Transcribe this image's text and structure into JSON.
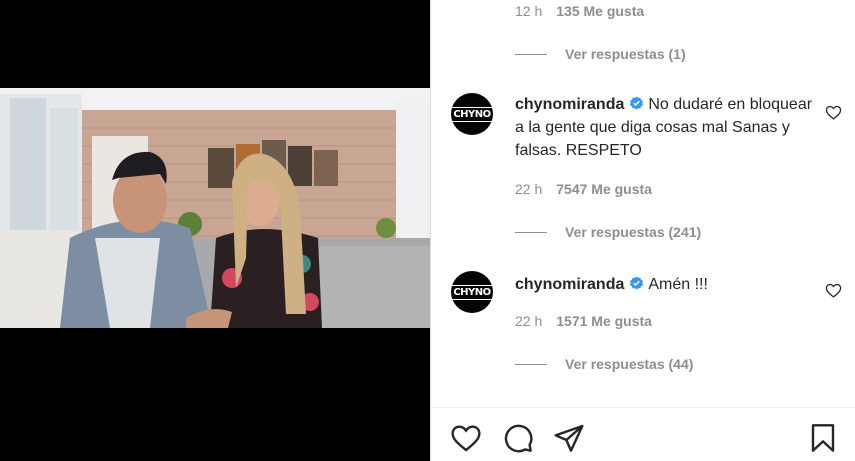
{
  "post": {
    "media_description_icon": "video-frame",
    "top_comment_meta": {
      "time": "12 h",
      "likes": "135 Me gusta"
    },
    "top_replies": "Ver respuestas (1)",
    "comments": [
      {
        "avatar_text": "CHYNO",
        "username": "chynomiranda",
        "text": "No dudaré en bloquear a la gente que diga cosas mal Sanas y falsas. RESPETO",
        "time": "22 h",
        "likes": "7547 Me gusta",
        "replies": "Ver respuestas (241)"
      },
      {
        "avatar_text": "CHYNO",
        "username": "chynomiranda",
        "text": "Amén !!!",
        "time": "22 h",
        "likes": "1571 Me gusta",
        "replies": "Ver respuestas (44)"
      }
    ],
    "actions": [
      "heart-icon",
      "comment-icon",
      "share-icon",
      "bookmark-icon"
    ],
    "colors": {
      "verified": "#3897f0",
      "text": "#262626",
      "muted": "#8e8e8e"
    }
  }
}
